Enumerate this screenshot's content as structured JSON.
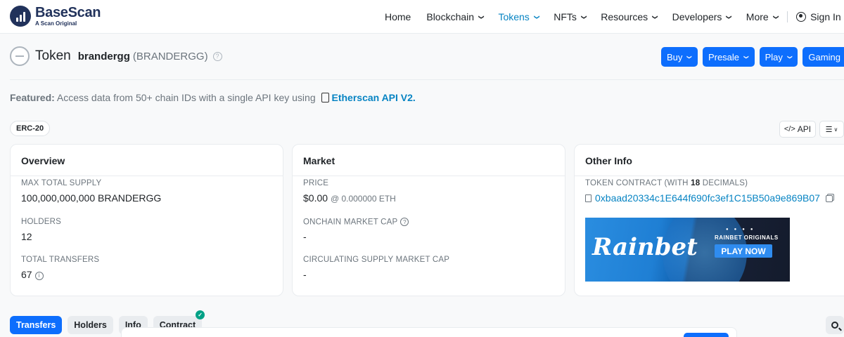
{
  "header": {
    "brand": "BaseScan",
    "brand_sub": "A Scan Original",
    "nav": [
      {
        "label": "Home",
        "active": false,
        "dropdown": false
      },
      {
        "label": "Blockchain",
        "active": false,
        "dropdown": true
      },
      {
        "label": "Tokens",
        "active": true,
        "dropdown": true
      },
      {
        "label": "NFTs",
        "active": false,
        "dropdown": true
      },
      {
        "label": "Resources",
        "active": false,
        "dropdown": true
      },
      {
        "label": "Developers",
        "active": false,
        "dropdown": true
      },
      {
        "label": "More",
        "active": false,
        "dropdown": true
      }
    ],
    "signin_label": "Sign In"
  },
  "token": {
    "label": "Token",
    "name": "brandergg",
    "symbol": "(BRANDERGG)"
  },
  "actions": [
    "Buy",
    "Presale",
    "Play",
    "Gaming"
  ],
  "featured": {
    "prefix": "Featured:",
    "text": "Access data from 50+ chain IDs with a single API key using",
    "link": "Etherscan API V2."
  },
  "badge": "ERC-20",
  "api_label": "API",
  "overview": {
    "title": "Overview",
    "max_supply_label": "MAX TOTAL SUPPLY",
    "max_supply_value": "100,000,000,000 BRANDERGG",
    "holders_label": "HOLDERS",
    "holders_value": "12",
    "transfers_label": "TOTAL TRANSFERS",
    "transfers_value": "67"
  },
  "market": {
    "title": "Market",
    "price_label": "PRICE",
    "price_value": "$0.00",
    "price_eth": "@ 0.000000 ETH",
    "onchain_cap_label": "ONCHAIN MARKET CAP",
    "onchain_cap_value": "-",
    "circ_cap_label": "CIRCULATING SUPPLY MARKET CAP",
    "circ_cap_value": "-"
  },
  "other": {
    "title": "Other Info",
    "contract_label_prefix": "TOKEN CONTRACT (WITH",
    "decimals": "18",
    "contract_label_suffix": "DECIMALS)",
    "contract_address": "0xbaad20334c1E644f690fc3ef1C15B50a9e869B07"
  },
  "ad": {
    "brand": "Rainbet",
    "tagline": "RAINBET ORIGINALS",
    "cta": "PLAY NOW"
  },
  "tabs": [
    {
      "label": "Transfers",
      "active": true
    },
    {
      "label": "Holders",
      "active": false
    },
    {
      "label": "Info",
      "active": false
    },
    {
      "label": "Contract",
      "active": false,
      "verified": true
    }
  ],
  "colors": {
    "accent": "#0d6efd",
    "link": "#0784c3",
    "verified": "#00a186"
  }
}
